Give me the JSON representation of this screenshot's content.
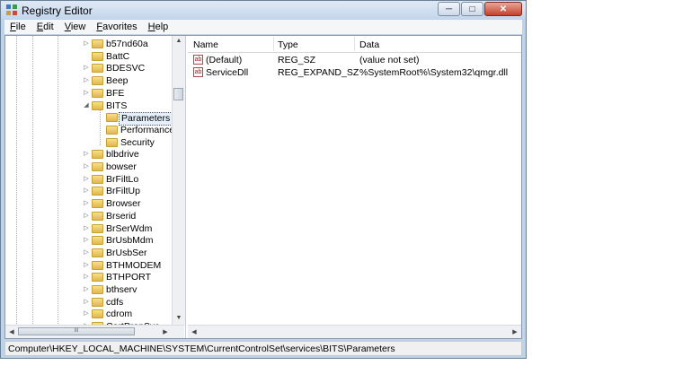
{
  "window": {
    "title": "Registry Editor",
    "minimize": "─",
    "maximize": "□",
    "close": "✕"
  },
  "menu": [
    {
      "key": "F",
      "rest": "ile"
    },
    {
      "key": "E",
      "rest": "dit"
    },
    {
      "key": "V",
      "rest": "iew"
    },
    {
      "key": "F",
      "rest": "avorites",
      "prefix": ""
    },
    {
      "key": "H",
      "rest": "elp"
    }
  ],
  "tree": [
    {
      "label": "b57nd60a",
      "level": 1,
      "expander": "▷"
    },
    {
      "label": "BattC",
      "level": 1,
      "expander": ""
    },
    {
      "label": "BDESVC",
      "level": 1,
      "expander": "▷"
    },
    {
      "label": "Beep",
      "level": 1,
      "expander": "▷"
    },
    {
      "label": "BFE",
      "level": 1,
      "expander": "▷"
    },
    {
      "label": "BITS",
      "level": 1,
      "expander": "◢"
    },
    {
      "label": "Parameters",
      "level": 2,
      "expander": "",
      "selected": true
    },
    {
      "label": "Performance",
      "level": 2,
      "expander": ""
    },
    {
      "label": "Security",
      "level": 2,
      "expander": ""
    },
    {
      "label": "blbdrive",
      "level": 1,
      "expander": "▷"
    },
    {
      "label": "bowser",
      "level": 1,
      "expander": "▷"
    },
    {
      "label": "BrFiltLo",
      "level": 1,
      "expander": "▷"
    },
    {
      "label": "BrFiltUp",
      "level": 1,
      "expander": "▷"
    },
    {
      "label": "Browser",
      "level": 1,
      "expander": "▷"
    },
    {
      "label": "Brserid",
      "level": 1,
      "expander": "▷"
    },
    {
      "label": "BrSerWdm",
      "level": 1,
      "expander": "▷"
    },
    {
      "label": "BrUsbMdm",
      "level": 1,
      "expander": "▷"
    },
    {
      "label": "BrUsbSer",
      "level": 1,
      "expander": "▷"
    },
    {
      "label": "BTHMODEM",
      "level": 1,
      "expander": "▷"
    },
    {
      "label": "BTHPORT",
      "level": 1,
      "expander": "▷"
    },
    {
      "label": "bthserv",
      "level": 1,
      "expander": "▷"
    },
    {
      "label": "cdfs",
      "level": 1,
      "expander": "▷"
    },
    {
      "label": "cdrom",
      "level": 1,
      "expander": "▷"
    },
    {
      "label": "CertPropSvc",
      "level": 1,
      "expander": "▷"
    }
  ],
  "list": {
    "headers": [
      "Name",
      "Type",
      "Data"
    ],
    "rows": [
      {
        "icon": "ab",
        "name": "(Default)",
        "type": "REG_SZ",
        "data": "(value not set)"
      },
      {
        "icon": "ab",
        "name": "ServiceDll",
        "type": "REG_EXPAND_SZ",
        "data": "%SystemRoot%\\System32\\qmgr.dll"
      }
    ]
  },
  "scroll": {
    "up": "▲",
    "down": "▼",
    "left": "◀",
    "right": "▶",
    "grip": "III"
  },
  "status": "Computer\\HKEY_LOCAL_MACHINE\\SYSTEM\\CurrentControlSet\\services\\BITS\\Parameters"
}
